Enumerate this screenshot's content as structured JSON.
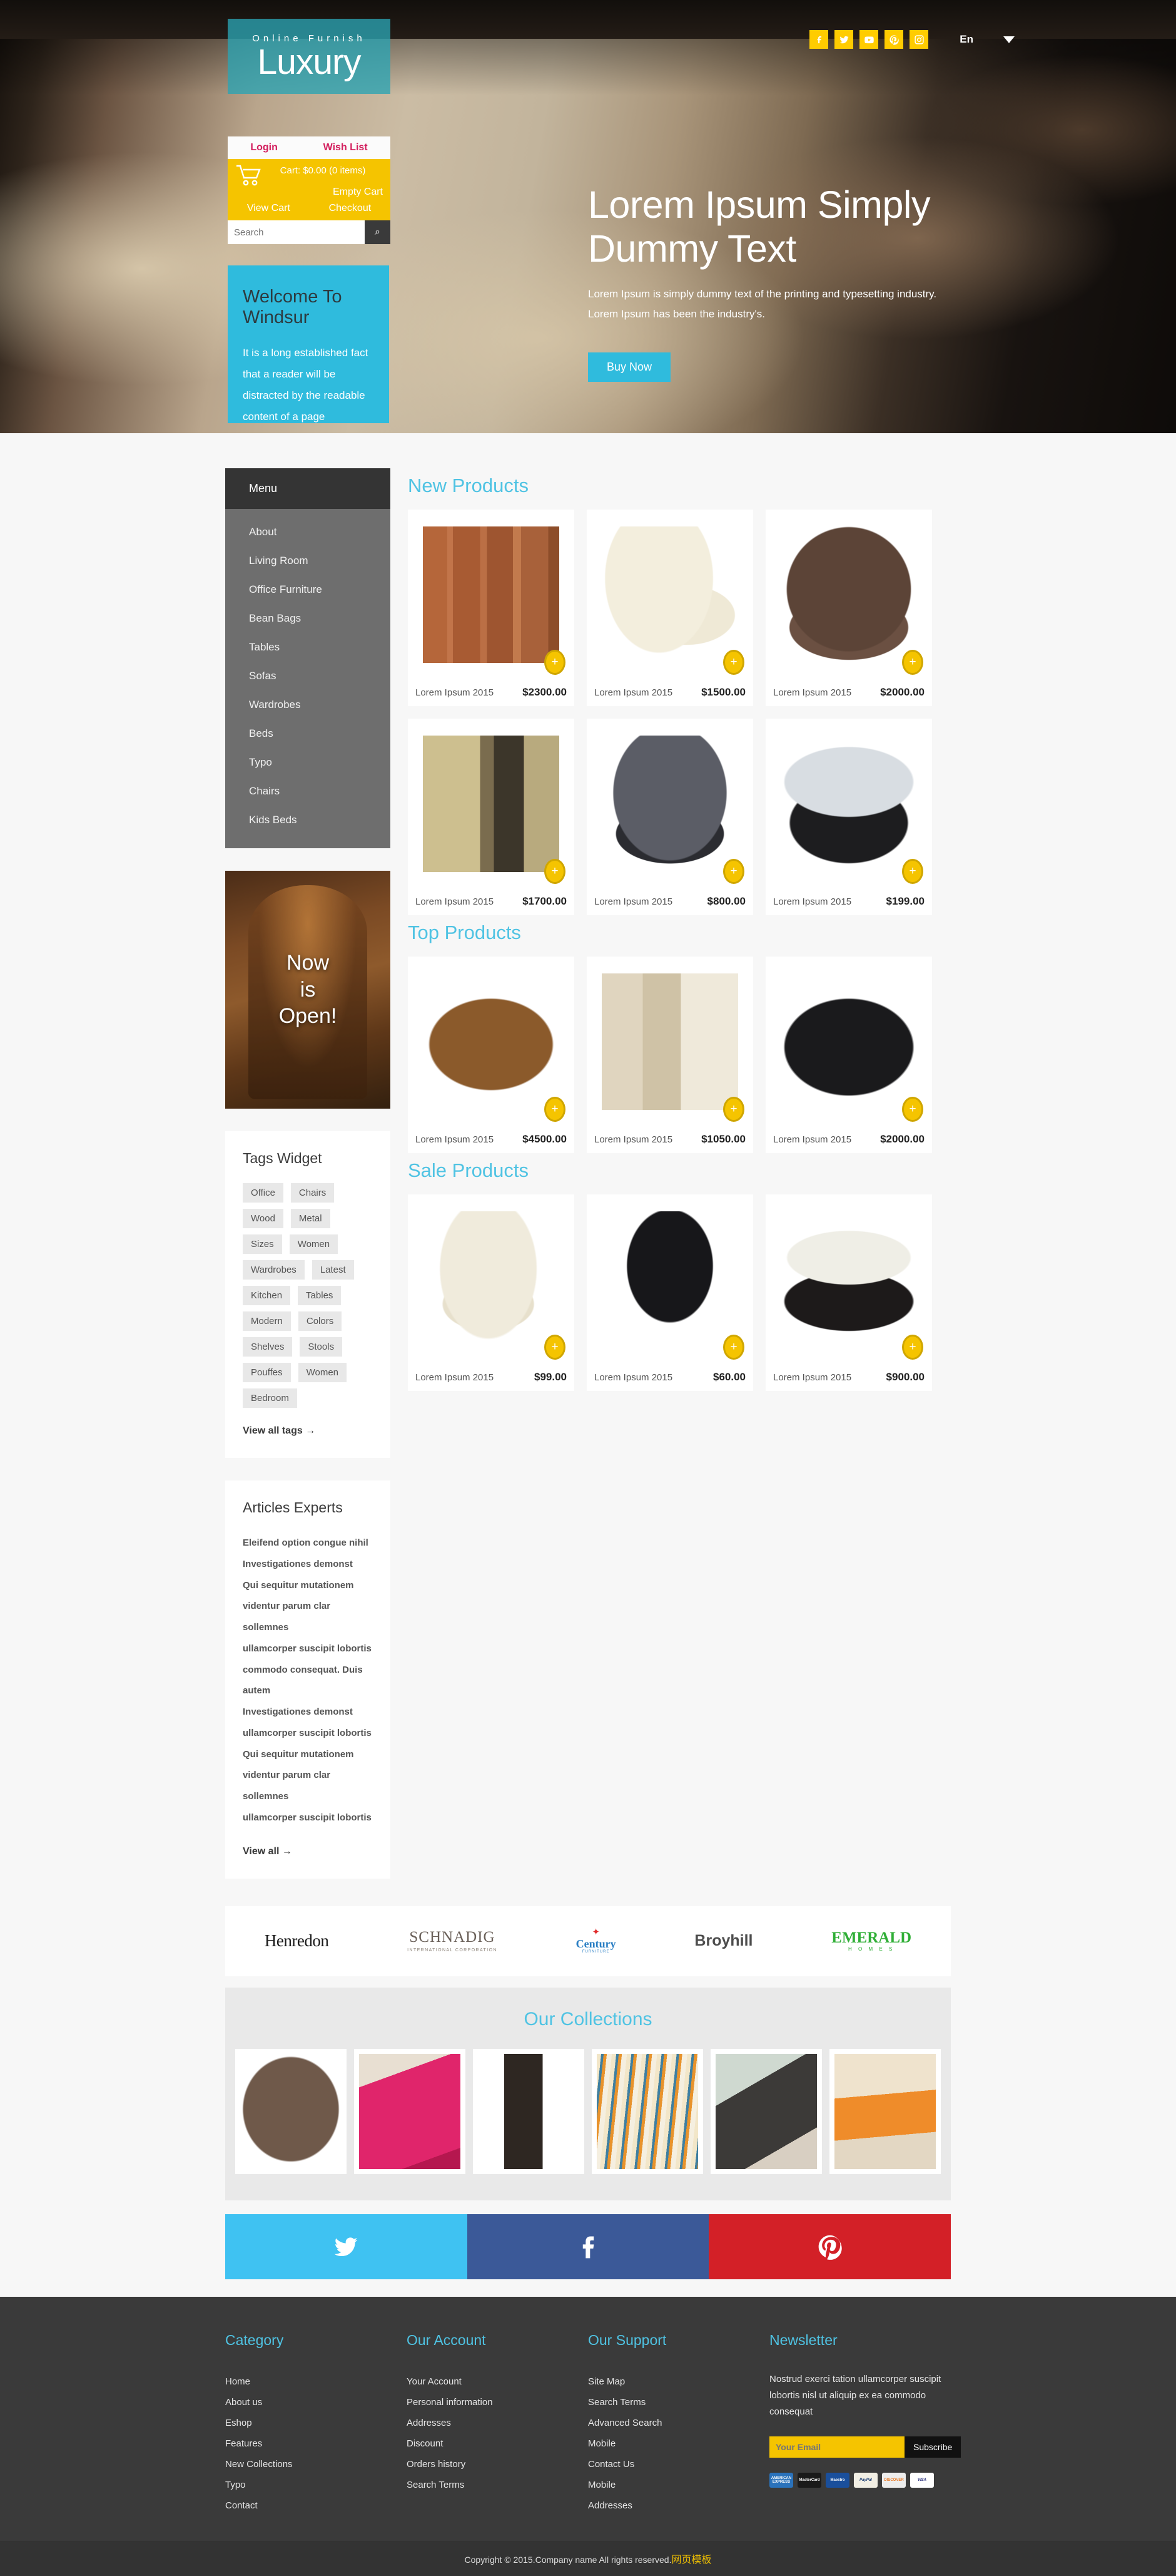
{
  "header": {
    "logo_small": "Online Furnish",
    "logo_main": "Luxury",
    "social": [
      {
        "name": "facebook-icon",
        "label": "f"
      },
      {
        "name": "twitter-icon",
        "label": "t"
      },
      {
        "name": "youtube-icon",
        "label": "yt"
      },
      {
        "name": "pinterest-icon",
        "label": "p"
      },
      {
        "name": "instagram-icon",
        "label": "ig"
      }
    ],
    "language": "En"
  },
  "account": {
    "login": "Login",
    "wishlist": "Wish List",
    "cart_summary": "Cart: $0.00 (0 items)",
    "empty_cart": "Empty Cart",
    "view_cart": "View Cart",
    "checkout": "Checkout",
    "search_placeholder": "Search",
    "search_icon": "⌕"
  },
  "welcome": {
    "title": "Welcome To Windsur",
    "text": "It is a long established fact that a reader will be distracted by the readable content of a page"
  },
  "hero": {
    "title": "Lorem Ipsum Simply Dummy Text",
    "text": "Lorem Ipsum is simply dummy text of the printing and typesetting industry. Lorem Ipsum has been the industry's.",
    "button": "Buy Now"
  },
  "menu": {
    "head": "Menu",
    "items": [
      "About",
      "Living Room",
      "Office Furniture",
      "Bean Bags",
      "Tables",
      "Sofas",
      "Wardrobes",
      "Beds",
      "Typo",
      "Chairs",
      "Kids Beds"
    ]
  },
  "promo": {
    "line1": "Now",
    "line2": "is",
    "line3": "Open!"
  },
  "tags_widget": {
    "title": "Tags Widget",
    "tags": [
      "Office",
      "Chairs",
      "Wood",
      "Metal",
      "Sizes",
      "Women",
      "Wardrobes",
      "Latest",
      "Kitchen",
      "Tables",
      "Modern",
      "Colors",
      "Shelves",
      "Stools",
      "Pouffes",
      "Women",
      "Bedroom"
    ],
    "view_all": "View all tags →"
  },
  "articles": {
    "title": "Articles Experts",
    "items": [
      "Eleifend option congue nihil",
      "Investigationes demonst",
      "Qui sequitur mutationem",
      "videntur parum clar sollemnes",
      "ullamcorper suscipit lobortis",
      "commodo consequat. Duis autem",
      "Investigationes demonst",
      "ullamcorper suscipit lobortis",
      "Qui sequitur mutationem",
      "videntur parum clar sollemnes",
      "ullamcorper suscipit lobortis"
    ],
    "view_all": "View all →"
  },
  "sections": [
    {
      "title": "New Products",
      "products": [
        {
          "name": "Lorem Ipsum 2015",
          "price": "$2300.00",
          "art": "a-wardrobe"
        },
        {
          "name": "Lorem Ipsum 2015",
          "price": "$1500.00",
          "art": "a-chair-cream"
        },
        {
          "name": "Lorem Ipsum 2015",
          "price": "$2000.00",
          "art": "a-recliner-brown"
        },
        {
          "name": "Lorem Ipsum 2015",
          "price": "$1700.00",
          "art": "a-cabinet"
        },
        {
          "name": "Lorem Ipsum 2015",
          "price": "$800.00",
          "art": "a-wing-grey"
        },
        {
          "name": "Lorem Ipsum 2015",
          "price": "$199.00",
          "art": "a-table-black"
        }
      ]
    },
    {
      "title": "Top Products",
      "products": [
        {
          "name": "Lorem Ipsum 2015",
          "price": "$4500.00",
          "art": "a-bed-metal"
        },
        {
          "name": "Lorem Ipsum 2015",
          "price": "$1050.00",
          "art": "a-bunk"
        },
        {
          "name": "Lorem Ipsum 2015",
          "price": "$2000.00",
          "art": "a-sofa-black"
        }
      ]
    },
    {
      "title": "Sale Products",
      "products": [
        {
          "name": "Lorem Ipsum 2015",
          "price": "$99.00",
          "art": "a-chair-gold"
        },
        {
          "name": "Lorem Ipsum 2015",
          "price": "$60.00",
          "art": "a-camp-chair"
        },
        {
          "name": "Lorem Ipsum 2015",
          "price": "$900.00",
          "art": "a-bed-dark"
        }
      ]
    }
  ],
  "add_icon": "+",
  "brands": [
    {
      "name": "Henredon",
      "sub": ""
    },
    {
      "name": "SCHNADIG",
      "sub": "INTERNATIONAL CORPORATION"
    },
    {
      "name": "Century",
      "sub": "FURNITURE"
    },
    {
      "name": "Broyhill",
      "sub": ""
    },
    {
      "name": "EMERALD",
      "sub": "H O M E S"
    }
  ],
  "collections": {
    "title": "Our Collections",
    "items": [
      "c1",
      "c2",
      "c3",
      "c4",
      "c5",
      "c6"
    ]
  },
  "social_stripe": [
    {
      "name": "twitter-icon",
      "class": "ss-tw"
    },
    {
      "name": "facebook-icon",
      "class": "ss-fb"
    },
    {
      "name": "pinterest-icon",
      "class": "ss-pin"
    }
  ],
  "footer": {
    "columns": [
      {
        "title": "Category",
        "items": [
          "Home",
          "About us",
          "Eshop",
          "Features",
          "New Collections",
          "Typo",
          "Contact"
        ]
      },
      {
        "title": "Our Account",
        "items": [
          "Your Account",
          "Personal information",
          "Addresses",
          "Discount",
          "Orders history",
          "Search Terms"
        ]
      },
      {
        "title": "Our Support",
        "items": [
          "Site Map",
          "Search Terms",
          "Advanced Search",
          "Mobile",
          "Contact Us",
          "Mobile",
          "Addresses"
        ]
      }
    ],
    "newsletter": {
      "title": "Newsletter",
      "text": "Nostrud exerci tation ullamcorper suscipit lobortis nisl ut aliquip ex ea commodo consequat",
      "email_placeholder": "Your Email",
      "subscribe": "Subscribe",
      "payments": [
        "AMERICAN EXPRESS",
        "MasterCard",
        "Maestro",
        "PayPal",
        "DISCOVER",
        "VISA"
      ]
    },
    "copyright": "Copyright © 2015.Company name All rights reserved.",
    "copyright_link": "网页模板"
  }
}
